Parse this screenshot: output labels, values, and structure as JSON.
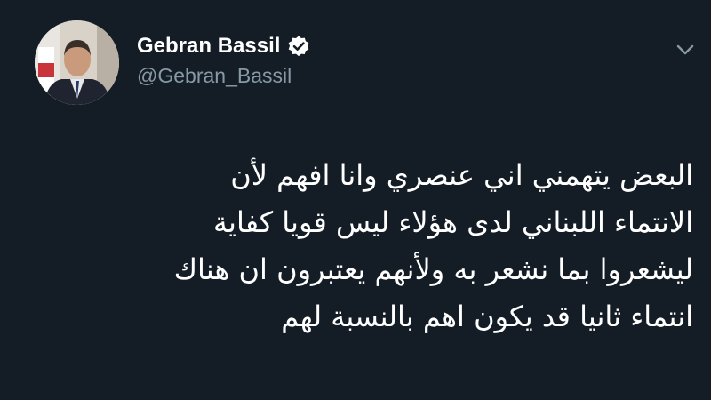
{
  "author": {
    "display_name": "Gebran Bassil",
    "handle": "@Gebran_Bassil",
    "verified_icon": "verified-badge-icon",
    "avatar_icon": "profile-photo"
  },
  "menu": {
    "icon": "chevron-down-icon"
  },
  "tweet": {
    "lines": [
      "البعض يتهمني اني عنصري وانا افهم لأن",
      "الانتماء اللبناني لدى هؤلاء ليس قويا كفاية",
      "ليشعروا بما نشعر به ولأنهم يعتبرون ان هناك",
      "انتماء ثانيا قد يكون اهم بالنسبة لهم"
    ]
  },
  "colors": {
    "background": "#141d26",
    "text": "#ffffff",
    "secondary_text": "#8899a6",
    "verified_badge": "#ffffff"
  }
}
